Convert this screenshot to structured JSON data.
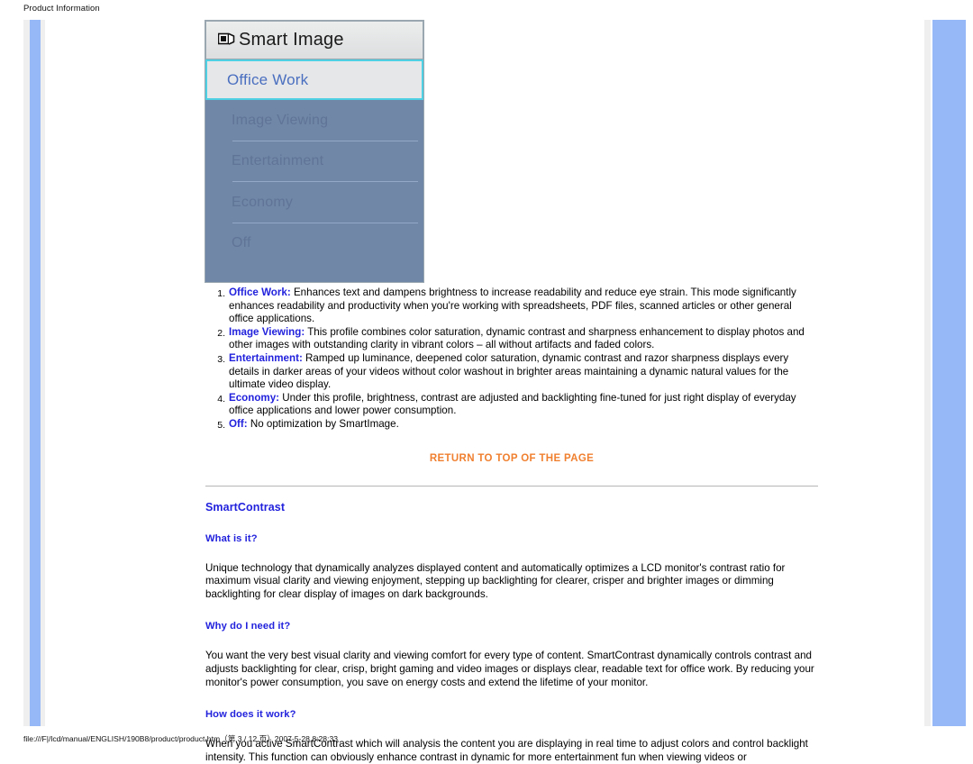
{
  "print_header": "Product Information",
  "print_footer": "file:///F|/lcd/manual/ENGLISH/190B8/product/product.htm（第 3 / 12 页）2007-5-28 8:28:33",
  "osd": {
    "title": "Smart Image",
    "icon": "smart-image-icon",
    "selected_item": "Office Work",
    "items": [
      "Image Viewing",
      "Entertainment",
      "Economy",
      "Off"
    ],
    "colors": {
      "panel_blue": "#7187a8",
      "selected_border": "#4fd0e3",
      "selected_text": "#4a6fc0",
      "item_text": "#5f7496",
      "title_bg": "#e6e7e8"
    }
  },
  "feature_list": [
    {
      "term": "Office Work:",
      "text": " Enhances text and dampens brightness to increase readability and reduce eye strain. This mode significantly enhances readability and productivity when you're working with spreadsheets, PDF files, scanned articles or other general office applications."
    },
    {
      "term": "Image Viewing:",
      "text": " This profile combines color saturation, dynamic contrast and sharpness enhancement to display photos and other images with outstanding clarity in vibrant colors – all without artifacts and faded colors."
    },
    {
      "term": "Entertainment:",
      "text": " Ramped up luminance, deepened color saturation, dynamic contrast and razor sharpness displays every details in darker areas of your videos without color washout in brighter areas maintaining a dynamic natural values for the ultimate video display."
    },
    {
      "term": "Economy:",
      "text": " Under this profile, brightness, contrast are adjusted and backlighting fine-tuned for just right display of everyday office applications and lower power consumption."
    },
    {
      "term": "Off:",
      "text": " No optimization by SmartImage."
    }
  ],
  "return_link": "RETURN TO TOP OF THE PAGE",
  "smartcontrast": {
    "title": "SmartContrast",
    "q1_heading": "What is it?",
    "q1_body": "Unique technology that dynamically analyzes displayed content and automatically optimizes a LCD monitor's contrast ratio for maximum visual clarity and viewing enjoyment, stepping up backlighting for clearer, crisper and brighter images or dimming backlighting for clear display of images on dark backgrounds.",
    "q2_heading": "Why do I need it?",
    "q2_body": "You want the very best visual clarity and viewing comfort for every type of content. SmartContrast dynamically controls contrast and adjusts backlighting for clear, crisp, bright gaming and video images or displays clear, readable text for office work. By reducing your monitor's power consumption, you save on energy costs and extend the lifetime of your monitor.",
    "q3_heading": "How does it work?",
    "q3_body": "When you active SmartContrast which will analysis the content you are displaying in real time to adjust colors and control backlight intensity. This function can obviously enhance contrast in dynamic for more entertainment fun when viewing videos or"
  },
  "colors": {
    "link_orange": "#f08030",
    "heading_blue": "#2222dd",
    "rail_blue": "#96b8f7",
    "page_gray": "#efefef"
  }
}
